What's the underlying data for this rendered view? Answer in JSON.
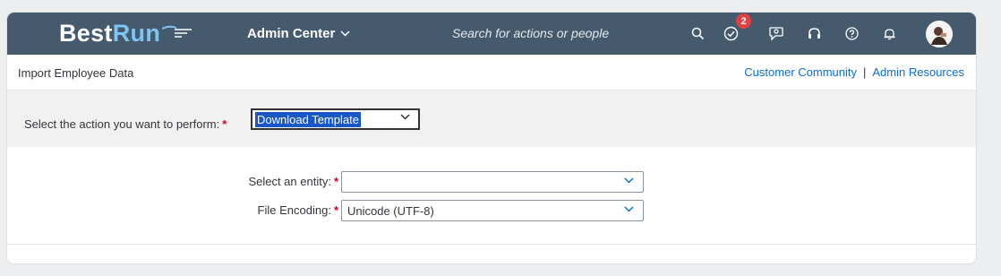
{
  "app": {
    "logo_primary": "Best",
    "logo_secondary": "Run",
    "menu_label": "Admin Center",
    "search_placeholder": "Search for actions or people",
    "notification_count": "2"
  },
  "header": {
    "page_title": "Import Employee Data",
    "links": [
      "Customer Community",
      "Admin Resources"
    ],
    "link_separator": "|"
  },
  "action": {
    "label": "Select the action you want to perform:",
    "required_mark": "*",
    "selected": "Download Template"
  },
  "form": {
    "entity_label": "Select an entity:",
    "entity_value": "",
    "encoding_label": "File Encoding:",
    "encoding_value": "Unicode (UTF-8)",
    "required_mark": "*"
  },
  "icons": {
    "header": [
      "search-icon",
      "todo-check-icon",
      "feedback-icon",
      "headset-icon",
      "help-icon",
      "bell-icon"
    ]
  },
  "colors": {
    "shell_bar": "#465a6e",
    "link": "#0a6ed1",
    "required": "#d9001b",
    "badge": "#e34141",
    "selection": "#1a57c6"
  }
}
